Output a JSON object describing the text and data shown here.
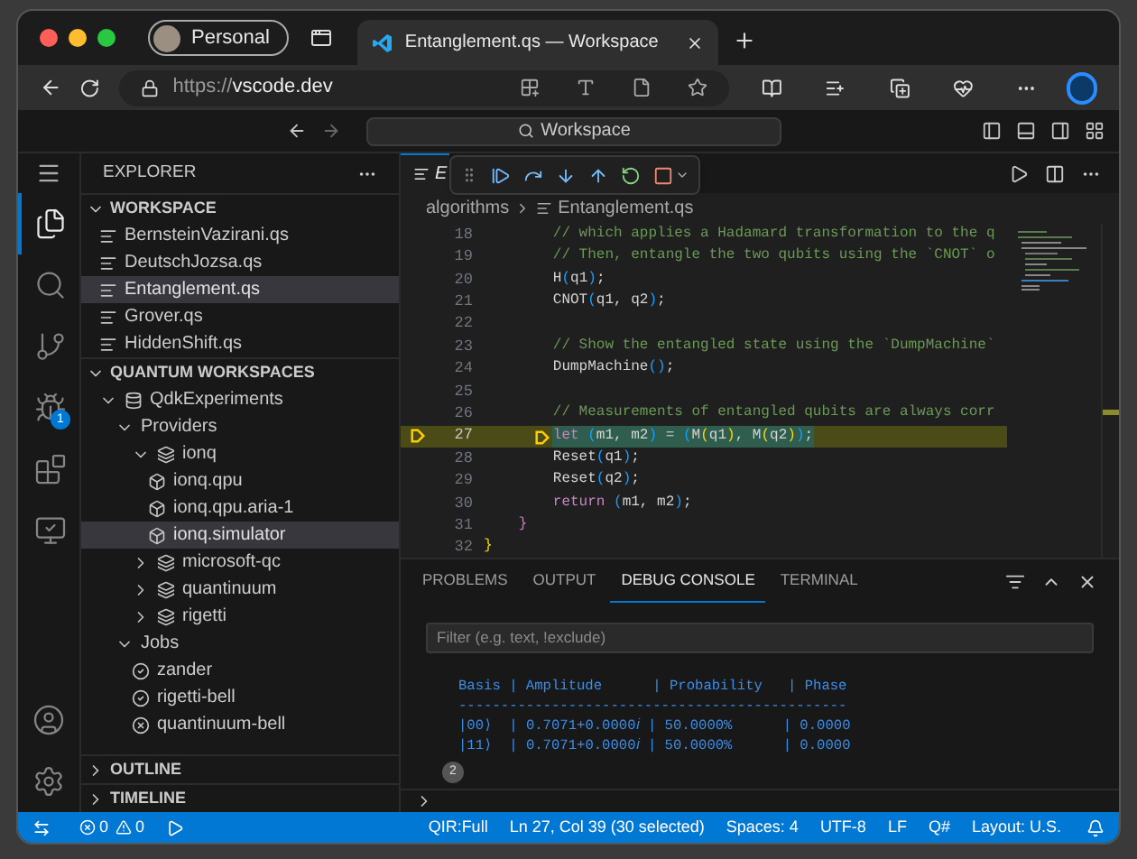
{
  "browser": {
    "profile": "Personal",
    "tab_title": "Entanglement.qs — Workspace",
    "url_scheme": "https://",
    "url_host": "vscode.dev"
  },
  "titlebar": {
    "search": "Workspace"
  },
  "activity_bar": [
    {
      "kind": "explorer",
      "selected": true
    },
    {
      "kind": "search",
      "selected": false
    },
    {
      "kind": "source-control",
      "selected": false
    },
    {
      "kind": "run-debug",
      "selected": false,
      "badge": "1"
    },
    {
      "kind": "extensions",
      "selected": false
    },
    {
      "kind": "remote",
      "selected": false
    }
  ],
  "activity_bar_bottom": [
    {
      "kind": "account"
    },
    {
      "kind": "settings"
    }
  ],
  "sidebar": {
    "title": "EXPLORER",
    "sections": [
      {
        "title": "WORKSPACE",
        "expanded": true,
        "items": [
          {
            "label": "BernsteinVazirani.qs",
            "kind": "file",
            "selected": false
          },
          {
            "label": "DeutschJozsa.qs",
            "kind": "file",
            "selected": false
          },
          {
            "label": "Entanglement.qs",
            "kind": "file",
            "selected": true
          },
          {
            "label": "Grover.qs",
            "kind": "file",
            "selected": false
          },
          {
            "label": "HiddenShift.qs",
            "kind": "file",
            "selected": false
          }
        ]
      },
      {
        "title": "QUANTUM WORKSPACES",
        "expanded": true,
        "items": [
          {
            "label": "QdkExperiments",
            "kind": "workspace",
            "selected": false,
            "expanded": true,
            "children": [
              {
                "label": "Providers",
                "kind": "group",
                "selected": false,
                "expanded": true,
                "children": [
                  {
                    "label": "ionq",
                    "kind": "provider",
                    "selected": false,
                    "expanded": true,
                    "children": [
                      {
                        "label": "ionq.qpu",
                        "kind": "target",
                        "selected": false
                      },
                      {
                        "label": "ionq.qpu.aria-1",
                        "kind": "target",
                        "selected": false
                      },
                      {
                        "label": "ionq.simulator",
                        "kind": "target",
                        "selected": true
                      }
                    ]
                  },
                  {
                    "label": "microsoft-qc",
                    "kind": "provider",
                    "selected": false,
                    "expanded": false
                  },
                  {
                    "label": "quantinuum",
                    "kind": "provider",
                    "selected": false,
                    "expanded": false
                  },
                  {
                    "label": "rigetti",
                    "kind": "provider",
                    "selected": false,
                    "expanded": false
                  }
                ]
              },
              {
                "label": "Jobs",
                "kind": "group",
                "selected": false,
                "expanded": true,
                "children": [
                  {
                    "label": "zander",
                    "kind": "job-succeeded",
                    "selected": false
                  },
                  {
                    "label": "rigetti-bell",
                    "kind": "job-succeeded",
                    "selected": false
                  },
                  {
                    "label": "quantinuum-bell",
                    "kind": "job-failed",
                    "selected": false
                  }
                ]
              }
            ]
          }
        ]
      },
      {
        "title": "OUTLINE",
        "expanded": false
      },
      {
        "title": "TIMELINE",
        "expanded": false
      }
    ]
  },
  "editor": {
    "tabs": [
      {
        "label": "E",
        "selected": true
      }
    ],
    "breadcrumb": [
      "algorithms",
      "Entanglement.qs"
    ],
    "lines": [
      {
        "number": "18",
        "current": false,
        "selected": false,
        "tokens": [
          {
            "kind": "comment",
            "text": "        // which applies a Hadamard transformation to the q"
          }
        ]
      },
      {
        "number": "19",
        "current": false,
        "selected": false,
        "tokens": [
          {
            "kind": "comment",
            "text": "        // Then, entangle the two qubits using the `CNOT` o"
          }
        ]
      },
      {
        "number": "20",
        "current": false,
        "selected": false,
        "tokens": [
          {
            "kind": "plain",
            "text": "        H"
          },
          {
            "kind": "bracket3",
            "text": "("
          },
          {
            "kind": "plain",
            "text": "q1"
          },
          {
            "kind": "bracket3",
            "text": ")"
          },
          {
            "kind": "plain",
            "text": ";"
          }
        ]
      },
      {
        "number": "21",
        "current": false,
        "selected": false,
        "tokens": [
          {
            "kind": "plain",
            "text": "        CNOT"
          },
          {
            "kind": "bracket3",
            "text": "("
          },
          {
            "kind": "plain",
            "text": "q1, q2"
          },
          {
            "kind": "bracket3",
            "text": ")"
          },
          {
            "kind": "plain",
            "text": ";"
          }
        ]
      },
      {
        "number": "22",
        "current": false,
        "selected": false
      },
      {
        "number": "23",
        "current": false,
        "selected": false,
        "tokens": [
          {
            "kind": "comment",
            "text": "        // Show the entangled state using the `DumpMachine`"
          }
        ]
      },
      {
        "number": "24",
        "current": false,
        "selected": false,
        "tokens": [
          {
            "kind": "plain",
            "text": "        DumpMachine"
          },
          {
            "kind": "bracket3",
            "text": "()"
          },
          {
            "kind": "plain",
            "text": ";"
          }
        ]
      },
      {
        "number": "25",
        "current": false,
        "selected": false
      },
      {
        "number": "26",
        "current": false,
        "selected": false,
        "tokens": [
          {
            "kind": "comment",
            "text": "        // Measurements of entangled qubits are always corr"
          }
        ]
      },
      {
        "number": "27",
        "current": true,
        "selected": true,
        "tokens": [
          {
            "kind": "keyword",
            "text": "        let"
          },
          {
            "kind": "bracket3",
            "text": " ("
          },
          {
            "kind": "plain",
            "text": "m1, m2"
          },
          {
            "kind": "bracket3",
            "text": ")"
          },
          {
            "kind": "plain",
            "text": " = "
          },
          {
            "kind": "bracket3",
            "text": "("
          },
          {
            "kind": "plain",
            "text": "M"
          },
          {
            "kind": "bracket1",
            "text": "("
          },
          {
            "kind": "plain",
            "text": "q1"
          },
          {
            "kind": "bracket1",
            "text": ")"
          },
          {
            "kind": "plain",
            "text": ", M"
          },
          {
            "kind": "bracket1",
            "text": "("
          },
          {
            "kind": "plain",
            "text": "q2"
          },
          {
            "kind": "bracket1",
            "text": ")"
          },
          {
            "kind": "bracket3",
            "text": ")"
          },
          {
            "kind": "plain",
            "text": ";"
          }
        ]
      },
      {
        "number": "28",
        "current": false,
        "selected": false,
        "tokens": [
          {
            "kind": "plain",
            "text": "        Reset"
          },
          {
            "kind": "bracket3",
            "text": "("
          },
          {
            "kind": "plain",
            "text": "q1"
          },
          {
            "kind": "bracket3",
            "text": ")"
          },
          {
            "kind": "plain",
            "text": ";"
          }
        ]
      },
      {
        "number": "29",
        "current": false,
        "selected": false,
        "tokens": [
          {
            "kind": "plain",
            "text": "        Reset"
          },
          {
            "kind": "bracket3",
            "text": "("
          },
          {
            "kind": "plain",
            "text": "q2"
          },
          {
            "kind": "bracket3",
            "text": ")"
          },
          {
            "kind": "plain",
            "text": ";"
          }
        ]
      },
      {
        "number": "30",
        "current": false,
        "selected": false,
        "tokens": [
          {
            "kind": "keyword",
            "text": "        return"
          },
          {
            "kind": "bracket3",
            "text": " ("
          },
          {
            "kind": "plain",
            "text": "m1, m2"
          },
          {
            "kind": "bracket3",
            "text": ")"
          },
          {
            "kind": "plain",
            "text": ";"
          }
        ]
      },
      {
        "number": "31",
        "current": false,
        "selected": false,
        "tokens": [
          {
            "kind": "bracket2",
            "text": "    }"
          }
        ]
      },
      {
        "number": "32",
        "current": false,
        "selected": false,
        "tokens": [
          {
            "kind": "bracket1",
            "text": "}"
          }
        ]
      }
    ]
  },
  "panel": {
    "tabs": [
      {
        "label": "PROBLEMS",
        "selected": false
      },
      {
        "label": "OUTPUT",
        "selected": false
      },
      {
        "label": "DEBUG CONSOLE",
        "selected": true
      },
      {
        "label": "TERMINAL",
        "selected": false
      }
    ],
    "filter_placeholder": "Filter (e.g. text, !exclude)",
    "output": [
      "Basis | Amplitude      | Probability   | Phase",
      "----------------------------------------------",
      "|00⟩  | 0.7071+0.0000𝑖 | 50.0000%      | 0.0000",
      "|11⟩  | 0.7071+0.0000𝑖 | 50.0000%      | 0.0000"
    ],
    "repeat_count": "2"
  },
  "status_bar": {
    "errors": "0",
    "warnings": "0",
    "items": [
      "QIR:Full",
      "Ln 27, Col 39 (30 selected)",
      "Spaces: 4",
      "UTF-8",
      "LF",
      "Q#",
      "Layout: U.S."
    ]
  }
}
